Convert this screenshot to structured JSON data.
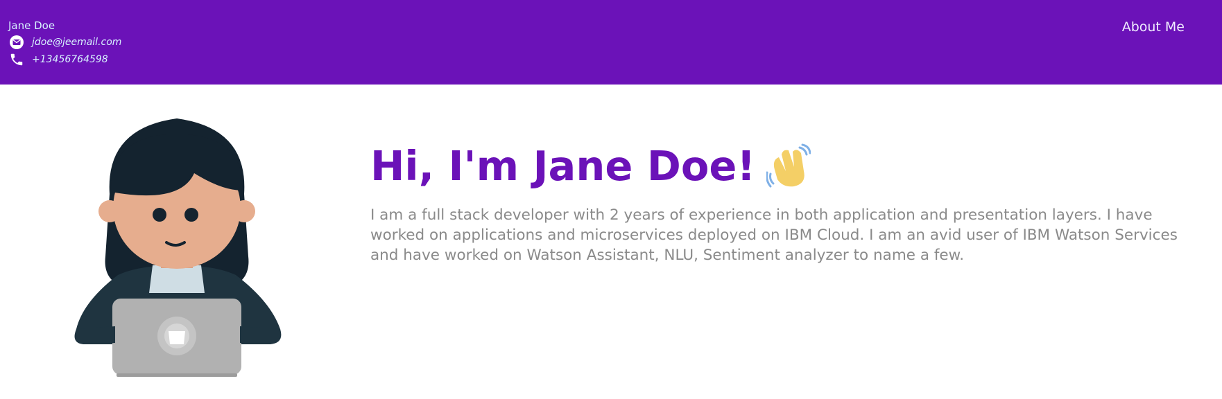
{
  "header": {
    "name": "Jane Doe",
    "email": "jdoe@jeemail.com",
    "phone": "+13456764598",
    "nav": {
      "about_label": "About Me"
    },
    "icons": {
      "email": "envelope-icon",
      "phone": "phone-icon"
    }
  },
  "hero": {
    "title": "Hi, I'm Jane Doe!",
    "title_icon": "waving-hand-icon",
    "bio": "I am a full stack developer with 2 years of experience in both application and presentation layers. I have worked on applications and microservices deployed on IBM Cloud. I am an avid user of IBM Watson Services and have worked on Watson Assistant, NLU, Sentiment analyzer to name a few."
  },
  "colors": {
    "primary": "#6b12b8",
    "contact_text": "#d8f3ff",
    "body_text": "#8a8a8a"
  }
}
